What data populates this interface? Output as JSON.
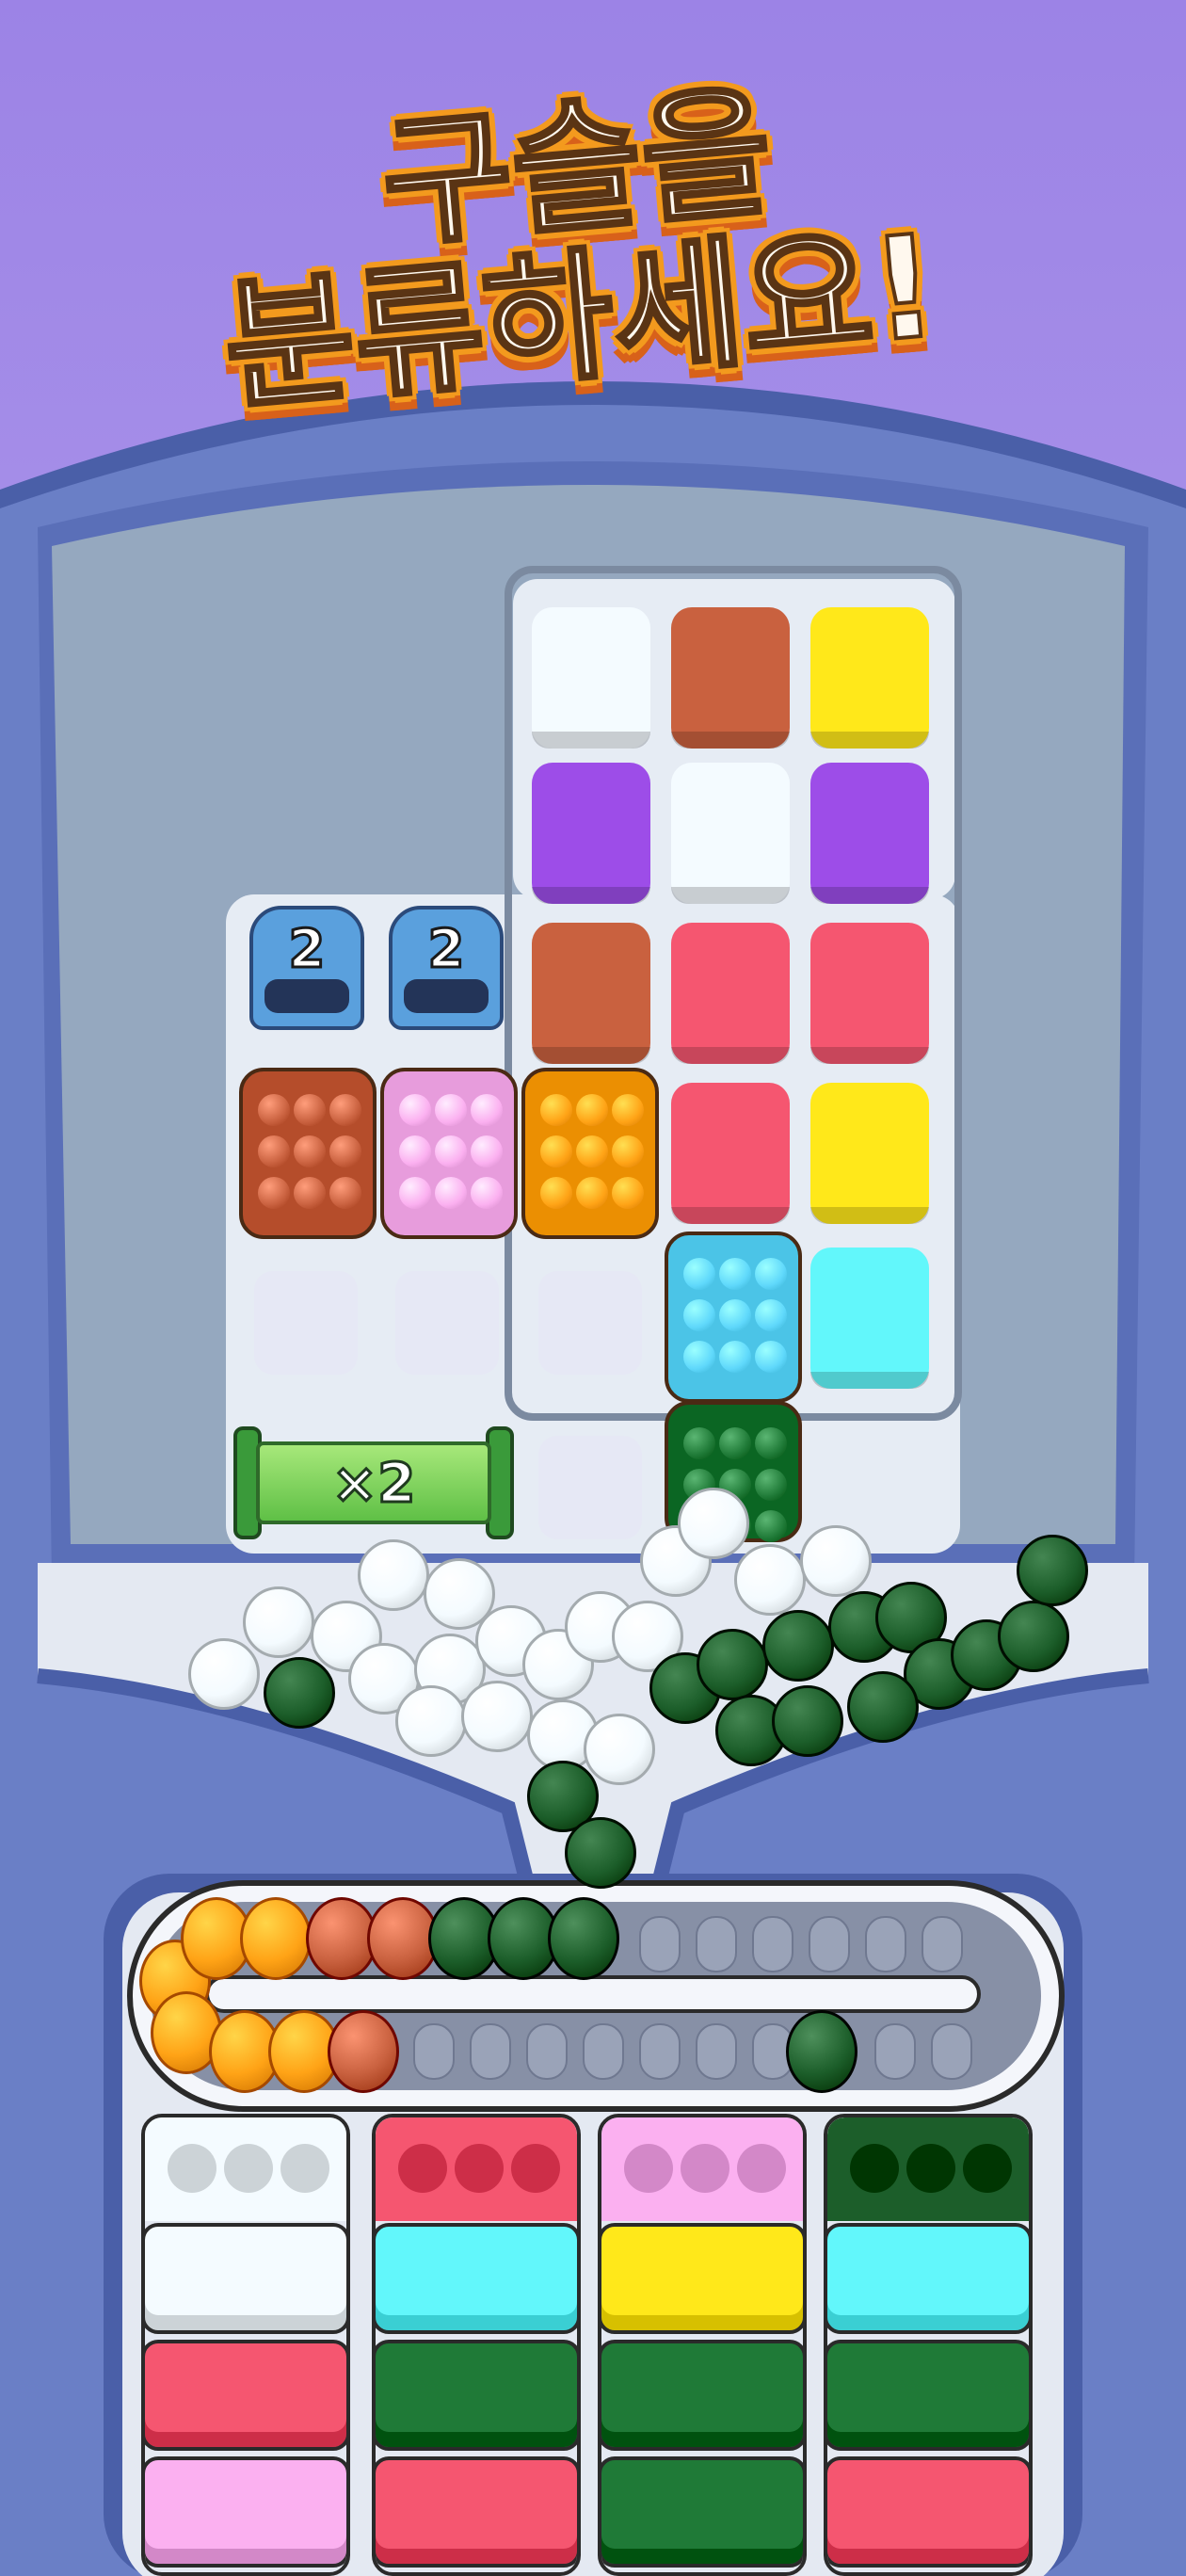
{
  "title": {
    "line1": "구슬을",
    "line2": "분류하세요!"
  },
  "pipes": [
    {
      "count": "2"
    },
    {
      "count": "2"
    }
  ],
  "multiplier": {
    "label": "×2"
  },
  "colors": {
    "white": "#f4fbff",
    "brown": "#c9613f",
    "yellow": "#ffe81a",
    "purple": "#9d4de8",
    "red": "#f55670",
    "pink": "#fbb0f0",
    "orange": "#ffa316",
    "blue": "#5fd8fb",
    "cyan": "#62f7fb",
    "green": "#1f7a37",
    "dark_green": "#1c5e2a"
  },
  "grid_blocks": [
    {
      "color": "white"
    },
    {
      "color": "brown"
    },
    {
      "color": "yellow"
    },
    {
      "color": "purple"
    },
    {
      "color": "white"
    },
    {
      "color": "purple"
    },
    {
      "color": "brown"
    },
    {
      "color": "red"
    },
    {
      "color": "red"
    },
    {
      "color": "red"
    },
    {
      "color": "yellow"
    },
    {
      "color": "cyan"
    }
  ],
  "trays": [
    {
      "color": "brown"
    },
    {
      "color": "pink"
    },
    {
      "color": "orange"
    },
    {
      "color": "blue"
    },
    {
      "color": "green"
    }
  ],
  "cups": [
    {
      "top": "white",
      "stack": [
        "white",
        "red",
        "pink"
      ]
    },
    {
      "top": "red",
      "stack": [
        "cyan",
        "green",
        "red"
      ]
    },
    {
      "top": "pink",
      "stack": [
        "yellow",
        "green",
        "green"
      ]
    },
    {
      "top": "dark_green",
      "stack": [
        "cyan",
        "green",
        "red"
      ]
    }
  ]
}
